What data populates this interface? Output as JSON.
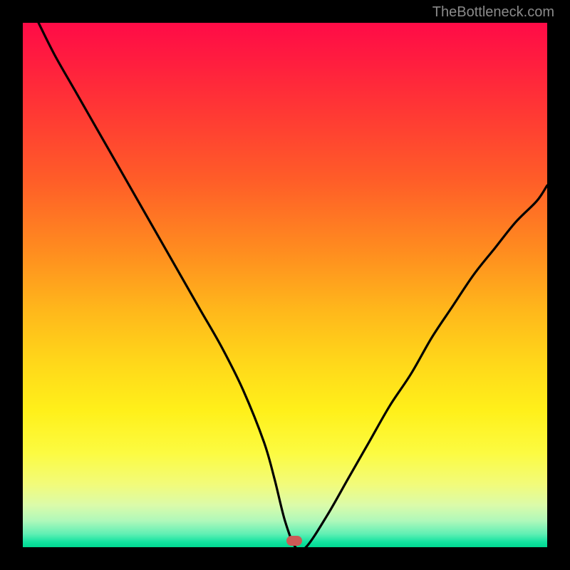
{
  "attribution": "TheBottleneck.com",
  "marker": {
    "x_pct": 51.8,
    "y_pct": 99.0
  },
  "chart_data": {
    "type": "line",
    "title": "",
    "xlabel": "",
    "ylabel": "",
    "xlim": [
      0,
      100
    ],
    "ylim": [
      0,
      100
    ],
    "background_gradient_meaning": "red_high_to_green_low_bottleneck",
    "marker": {
      "x": 51.8,
      "y": 0
    },
    "series": [
      {
        "name": "bottleneck-curve",
        "x": [
          3,
          6,
          10,
          14,
          18,
          22,
          26,
          30,
          34,
          38,
          42,
          46,
          48,
          50,
          52,
          54,
          58,
          62,
          66,
          70,
          74,
          78,
          82,
          86,
          90,
          94,
          98,
          100
        ],
        "y": [
          100,
          94,
          87,
          80,
          73,
          66,
          59,
          52,
          45,
          38,
          30,
          20,
          13,
          5,
          0,
          0,
          6,
          13,
          20,
          27,
          33,
          40,
          46,
          52,
          57,
          62,
          66,
          69
        ]
      }
    ]
  }
}
